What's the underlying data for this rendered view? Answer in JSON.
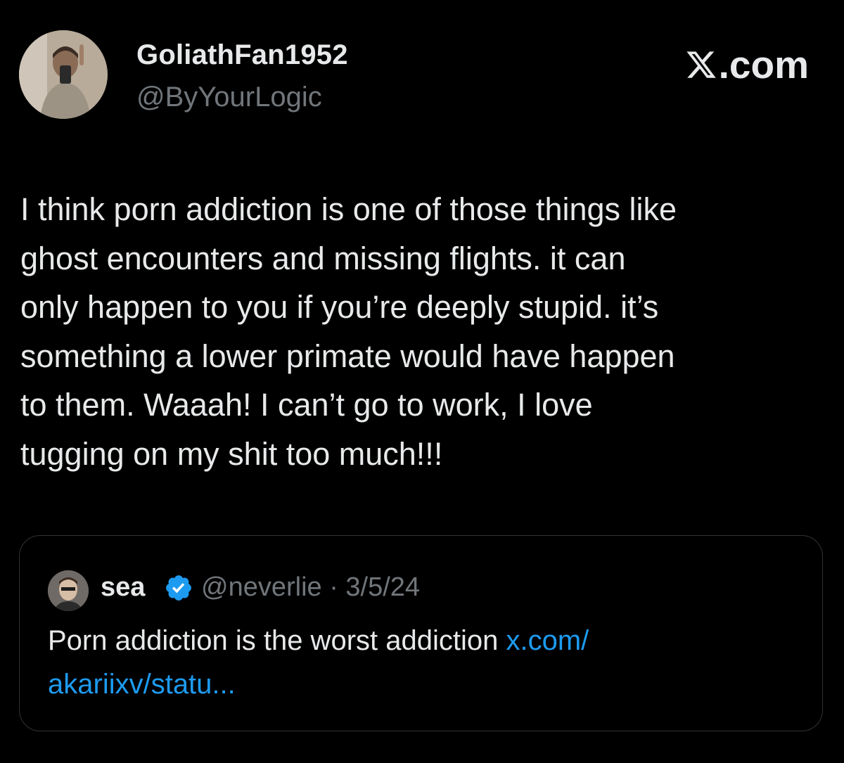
{
  "header": {
    "display_name": "GoliathFan1952",
    "handle": "@ByYourLogic",
    "brand": ".com",
    "brand_icon": "x-logo-icon"
  },
  "tweet": {
    "text": "I think porn addiction is one of those things like\nghost encounters and missing flights. it can\nonly happen to you if you’re deeply stupid. it’s\nsomething a lower primate would have happen\nto them. Waaah! I can’t go to work, I love\ntugging on my shit too much!!!"
  },
  "quoted_tweet": {
    "display_name": "sea",
    "verified_icon": "verified-badge-icon",
    "handle_and_date": "@neverlie · 3/5/24",
    "text": "Porn addiction is the worst addiction ",
    "link_text": "x.com/\nakariixv/statu..."
  },
  "colors": {
    "background": "#000000",
    "primary_text": "#e7e9ea",
    "secondary_text": "#71767b",
    "link": "#1d9bf0",
    "border": "#2f3336"
  }
}
